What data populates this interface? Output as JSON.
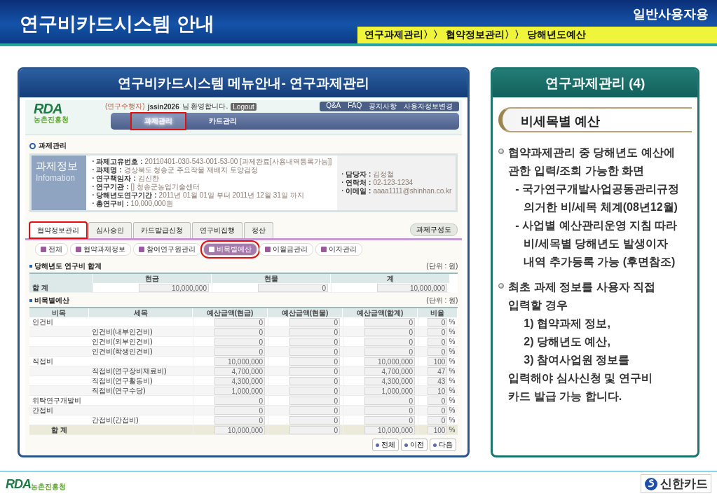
{
  "header": {
    "title": "연구비카드시스템 안내",
    "badge": "일반사용자용",
    "breadcrumb": "연구과제관리〉〉 협약정보관리〉〉 당해년도예산"
  },
  "left_panel": {
    "title": "연구비카드시스템 메뉴안내- 연구과제관리",
    "app": {
      "logo": {
        "mark": "RDA",
        "name": "농촌진흥청"
      },
      "greeting": {
        "role": "(연구수행자)",
        "user": "jssin2026",
        "suffix": "님 환영합니다.",
        "logout": "Logout"
      },
      "top_links": [
        "Q&A",
        "FAQ",
        "공지사항",
        "사용자정보변경"
      ],
      "menu": [
        {
          "label": "과제관리",
          "selected": true,
          "highlighted": true
        },
        {
          "label": "카드관리",
          "selected": false,
          "highlighted": false
        }
      ],
      "section_title": "과제관리",
      "info": {
        "label": "과제정보",
        "sublabel": "Infomation",
        "fields": [
          {
            "label": "· 과제고유번호 :",
            "value": "20110401-030-543-001-53-00 [과제완료[사용내역등록가능]]"
          },
          {
            "label": "· 과제명 :",
            "value": "경상북도 청송군 주요작물 재배지 토양검정"
          },
          {
            "label": "· 연구책임자 :",
            "value": "김신한"
          },
          {
            "label": "· 연구기관 :",
            "value": "[] 청송군농업기술센터"
          },
          {
            "label": "· 당해년도연구기간 :",
            "value": "2011년 01월 01일 부터 2011년 12월 31일 까지"
          },
          {
            "label": "· 총연구비 :",
            "value": "10,000,000원"
          }
        ],
        "contacts": [
          {
            "label": "· 담당자 :",
            "value": "김정철"
          },
          {
            "label": "· 연락처 :",
            "value": "02-123-1234"
          },
          {
            "label": "· 이메일 :",
            "value": "aaaa1111@shinhan.co.kr"
          }
        ]
      },
      "tabs": [
        {
          "label": "협약정보관리",
          "selected": true,
          "highlighted": true
        },
        {
          "label": "심사승인",
          "selected": false,
          "highlighted": false
        },
        {
          "label": "카드발급신청",
          "selected": false,
          "highlighted": false
        },
        {
          "label": "연구비집행",
          "selected": false,
          "highlighted": false
        },
        {
          "label": "정산",
          "selected": false,
          "highlighted": false
        }
      ],
      "structure_button": "과제구성도",
      "subtabs": [
        {
          "label": "전체",
          "selected": false,
          "highlighted": false
        },
        {
          "label": "협약과제정보",
          "selected": false,
          "highlighted": false
        },
        {
          "label": "참여연구원관리",
          "selected": false,
          "highlighted": false
        },
        {
          "label": "비목별예산",
          "selected": true,
          "highlighted": true
        },
        {
          "label": "이월금관리",
          "selected": false,
          "highlighted": false
        },
        {
          "label": "이자관리",
          "selected": false,
          "highlighted": false
        }
      ],
      "totals": {
        "title": "당해년도 연구비 합계",
        "unit": "(단위 : 원)",
        "columns": [
          "현금",
          "현물",
          "계"
        ],
        "row_label": "합 계",
        "values": [
          "10,000,000",
          "0",
          "10,000,000"
        ]
      },
      "budget": {
        "title": "비목별예산",
        "unit": "(단위 : 원)",
        "columns": [
          "비목",
          "세목",
          "예산금액(현금)",
          "예산금액(현물)",
          "예산금액(합계)",
          "비율"
        ],
        "rows": [
          {
            "kind": "category",
            "category": "인건비",
            "cash": "0",
            "in_kind": "0",
            "total": "0",
            "ratio": "0",
            "percent": "%"
          },
          {
            "kind": "item",
            "subcategory": "인건비(내부인건비)",
            "cash": "0",
            "in_kind": "0",
            "total": "0",
            "ratio": "0",
            "percent": "%"
          },
          {
            "kind": "item",
            "subcategory": "인건비(외부인건비)",
            "cash": "0",
            "in_kind": "0",
            "total": "0",
            "ratio": "0",
            "percent": "%"
          },
          {
            "kind": "item",
            "subcategory": "인건비(학생인건비)",
            "cash": "0",
            "in_kind": "0",
            "total": "0",
            "ratio": "0",
            "percent": "%"
          },
          {
            "kind": "category",
            "category": "직접비",
            "cash": "10,000,000",
            "in_kind": "0",
            "total": "10,000,000",
            "ratio": "100",
            "percent": "%"
          },
          {
            "kind": "item",
            "subcategory": "직접비(연구장비재료비)",
            "cash": "4,700,000",
            "in_kind": "0",
            "total": "4,700,000",
            "ratio": "47",
            "percent": "%"
          },
          {
            "kind": "item",
            "subcategory": "직접비(연구활동비)",
            "cash": "4,300,000",
            "in_kind": "0",
            "total": "4,300,000",
            "ratio": "43",
            "percent": "%"
          },
          {
            "kind": "item",
            "subcategory": "직접비(연구수당)",
            "cash": "1,000,000",
            "in_kind": "0",
            "total": "1,000,000",
            "ratio": "10",
            "percent": "%"
          },
          {
            "kind": "category",
            "category": "위탁연구개발비",
            "cash": "0",
            "in_kind": "0",
            "total": "0",
            "ratio": "0",
            "percent": "%"
          },
          {
            "kind": "category",
            "category": "간접비",
            "cash": "0",
            "in_kind": "0",
            "total": "0",
            "ratio": "0",
            "percent": "%"
          },
          {
            "kind": "item",
            "subcategory": "간접비(간접비)",
            "cash": "0",
            "in_kind": "0",
            "total": "0",
            "ratio": "0",
            "percent": "%"
          },
          {
            "kind": "total",
            "category": "합 계",
            "cash": "10,000,000",
            "in_kind": "0",
            "total": "10,000,000",
            "ratio": "100",
            "percent": "%"
          }
        ]
      },
      "nav_buttons": [
        "전체",
        "이전",
        "다음"
      ]
    }
  },
  "right_panel": {
    "title": "연구과제관리 (4)",
    "subtitle": "비세목별 예산",
    "bullets": [
      {
        "lines": [
          {
            "kind": "text",
            "text": "협약과제관리 중 당해년도 예산에"
          },
          {
            "kind": "text",
            "text": "관한 입력/조회 가능한 화면"
          },
          {
            "kind": "sub",
            "text": "- 국가연구개발사업공동관리규정"
          },
          {
            "kind": "cont",
            "text": "의거한 비/세목 체계(08년12월)"
          },
          {
            "kind": "sub",
            "text": "- 사업별 예산관리운영 지침 따라"
          },
          {
            "kind": "cont",
            "text": "비/세목별 당해년도 발생이자"
          },
          {
            "kind": "cont",
            "text": "내역 추가등록 가능 (후면참조)"
          }
        ]
      },
      {
        "lines": [
          {
            "kind": "text",
            "text": "최초 과제 정보를 사용자 직접"
          },
          {
            "kind": "text",
            "text": "입력할 경우"
          },
          {
            "kind": "cont",
            "text": "1) 협약과제 정보,"
          },
          {
            "kind": "cont",
            "text": "2) 당해년도  예산,"
          },
          {
            "kind": "cont",
            "text": "3) 참여사업원 정보를"
          },
          {
            "kind": "text",
            "text": "입력해야 심사신청 및 연구비"
          },
          {
            "kind": "text",
            "text": "카드 발급 가능  합니다."
          }
        ]
      }
    ]
  },
  "footer": {
    "logo": {
      "mark": "RDA",
      "name": "농촌진흥청"
    },
    "partner": "신한카드"
  }
}
